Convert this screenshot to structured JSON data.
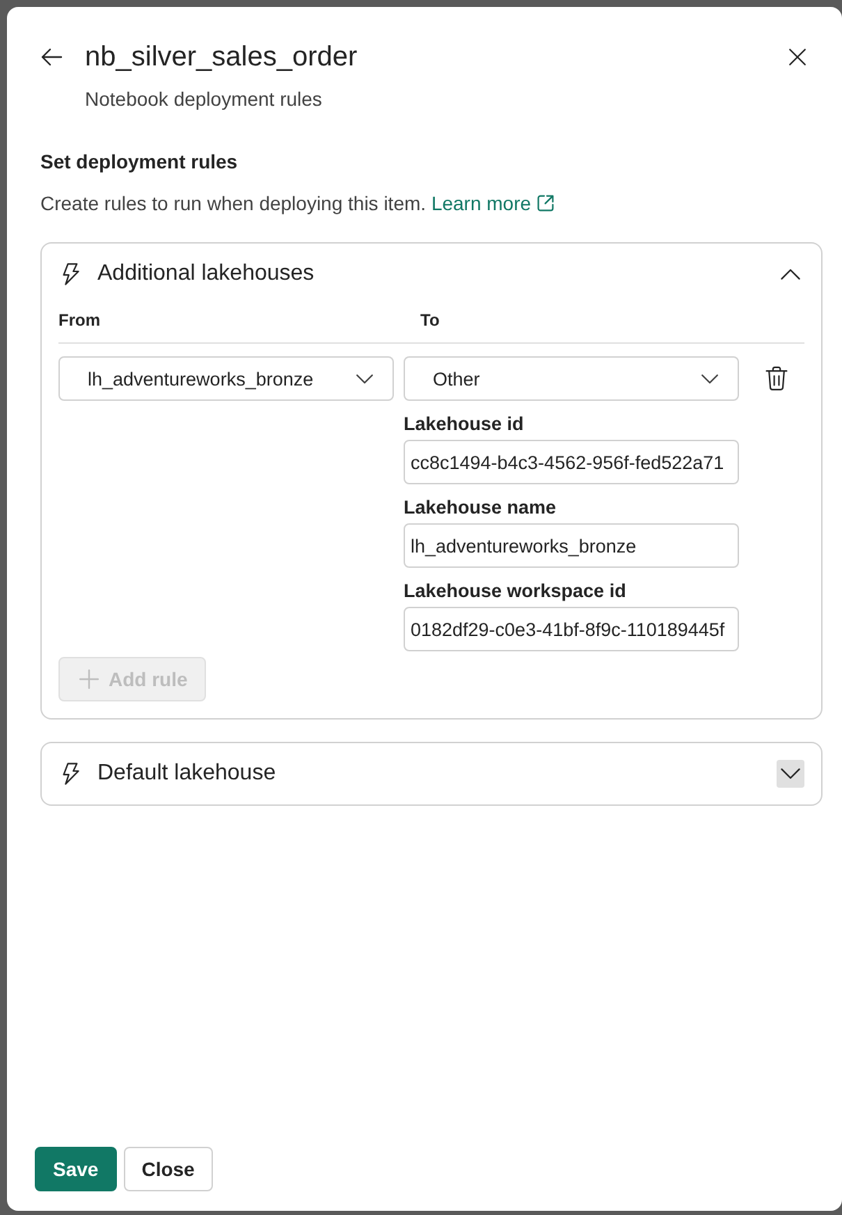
{
  "panel": {
    "title": "nb_silver_sales_order",
    "subtitle": "Notebook deployment rules"
  },
  "section": {
    "heading": "Set deployment rules",
    "description": "Create rules to run when deploying this item.",
    "link": "Learn more"
  },
  "rule_groups": [
    {
      "title": "Additional lakehouses",
      "expanded": true,
      "toggle_hovered": false,
      "columns": [
        "From",
        "To"
      ],
      "rules": [
        {
          "from": "lh_adventureworks_bronze",
          "to": "Other",
          "fields": [
            {
              "label": "Lakehouse id",
              "value": "cc8c1494-b4c3-4562-956f-fed522a71"
            },
            {
              "label": "Lakehouse name",
              "value": "lh_adventureworks_bronze"
            },
            {
              "label": "Lakehouse workspace id",
              "value": "0182df29-c0e3-41bf-8f9c-110189445f"
            }
          ]
        }
      ],
      "add_button": {
        "label": "Add rule",
        "disabled": true
      }
    },
    {
      "title": "Default lakehouse",
      "expanded": false,
      "toggle_hovered": true
    }
  ],
  "buttons": [
    {
      "label": "Save",
      "kind": "primary"
    },
    {
      "label": "Close",
      "kind": "secondary"
    }
  ]
}
